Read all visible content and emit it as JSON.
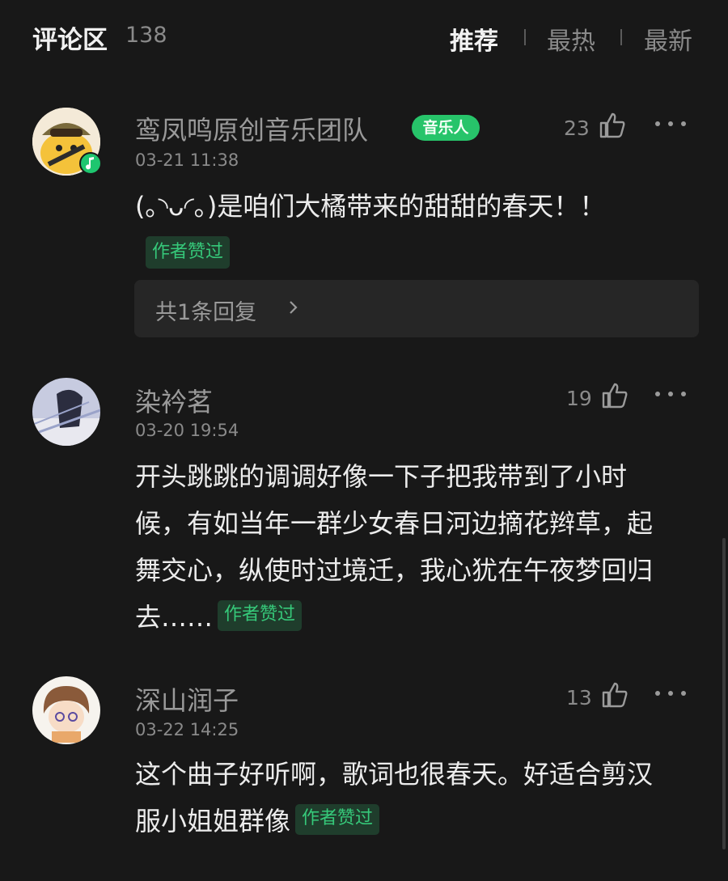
{
  "header": {
    "title": "评论区",
    "count": "138",
    "sort_options": [
      "推荐",
      "最热",
      "最新"
    ],
    "active_sort": "推荐"
  },
  "comments": [
    {
      "user": "鸾凤鸣原创音乐团队",
      "badge": "音乐人",
      "time": "03-21 11:38",
      "likes": "23",
      "text": "(｡◝ᴗ◜｡)是咱们大橘带来的甜甜的春天！！",
      "author_liked": "作者赞过",
      "reply_summary": "共1条回复"
    },
    {
      "user": "染衿茗",
      "time": "03-20 19:54",
      "likes": "19",
      "text": "开头跳跳的调调好像一下子把我带到了小时候，有如当年一群少女春日河边摘花辫草，起舞交心，纵使时过境迁，我心犹在午夜梦回归去……",
      "author_liked": "作者赞过"
    },
    {
      "user": "深山润子",
      "time": "03-22 14:25",
      "likes": "13",
      "text": "这个曲子好听啊，歌词也很春天。好适合剪汉服小姐姐群像",
      "author_liked": "作者赞过"
    }
  ],
  "icons": {
    "like": "thumbs-up-icon",
    "more": "more-dots-icon",
    "chevron": "chevron-right-icon"
  },
  "colors": {
    "background": "#181818",
    "accent_green": "#27c46a",
    "muted_text": "#8a8a8a"
  }
}
